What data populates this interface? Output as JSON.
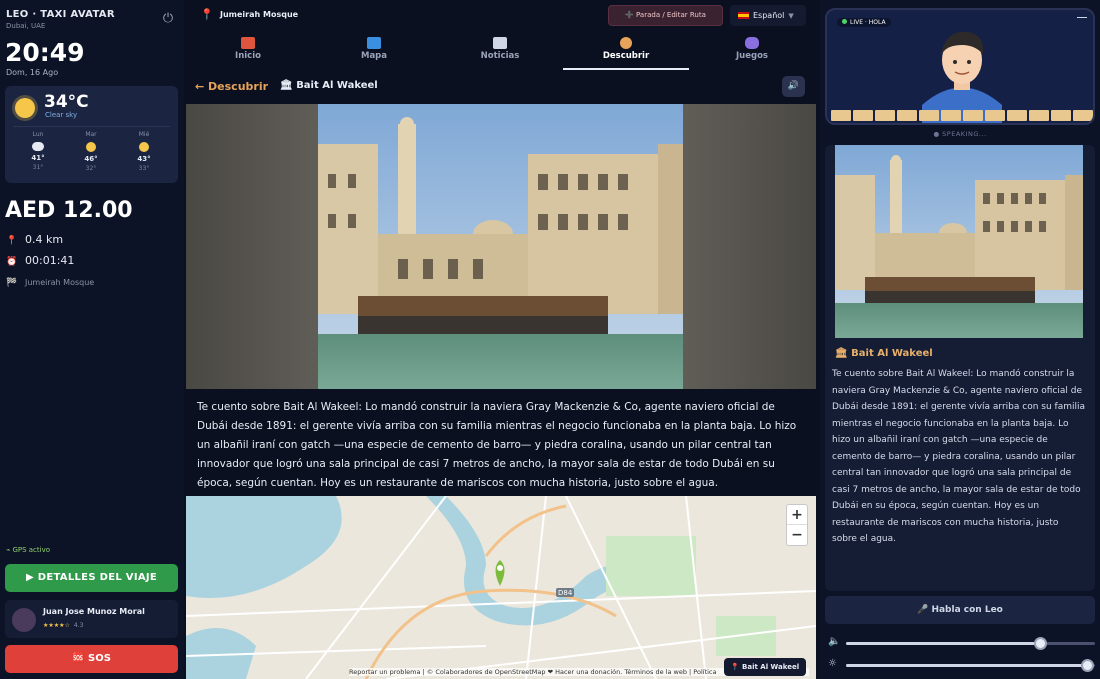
{
  "app": {
    "brand": "LEO · TAXI AVATAR",
    "location": "Dubai, UAE"
  },
  "clock": {
    "time": "20:49",
    "date": "Dom, 16 Ago"
  },
  "weather": {
    "temp": "34°C",
    "desc": "Clear sky",
    "forecast": [
      {
        "day": "Lun",
        "hi": "41°",
        "lo": "31°",
        "icon": "cloud-icon"
      },
      {
        "day": "Mar",
        "hi": "46°",
        "lo": "32°",
        "icon": "partly-sunny-icon"
      },
      {
        "day": "Mié",
        "hi": "43°",
        "lo": "33°",
        "icon": "partly-sunny-icon"
      }
    ]
  },
  "trip": {
    "fare": "AED 12.00",
    "distance": "0.4 km",
    "elapsed": "00:01:41",
    "destination": "Jumeirah Mosque"
  },
  "gps_status": "GPS activo",
  "buttons": {
    "details": "▶ DETALLES DEL VIAJE",
    "sos": "🆘 SOS",
    "talk": "🎤 Habla con Leo",
    "route": "➕ Parada / Editar Ruta"
  },
  "driver": {
    "name": "Juan Jose Munoz Moral",
    "stars": "★★★★☆",
    "rating": "4.3"
  },
  "topbar": {
    "current_location": "Jumeirah Mosque",
    "language": "Español"
  },
  "tabs": [
    {
      "label": "Inicio",
      "icon": "home-icon",
      "color": "#e0553d"
    },
    {
      "label": "Mapa",
      "icon": "map-icon",
      "color": "#3b8fe0"
    },
    {
      "label": "Noticias",
      "icon": "newspaper-icon",
      "color": "#cfd6e6"
    },
    {
      "label": "Descubrir",
      "icon": "compass-icon",
      "color": "#e8a35a"
    },
    {
      "label": "Juegos",
      "icon": "gamepad-icon",
      "color": "#8a6fe0"
    }
  ],
  "discover": {
    "back_label": "← Descubrir",
    "poi_title": "Bait Al Wakeel",
    "story": "Te cuento sobre Bait Al Wakeel: Lo mandó construir la naviera Gray Mackenzie & Co, agente naviero oficial de Dubái desde 1891: el gerente vivía arriba con su familia mientras el negocio funcionaba en la planta baja. Lo hizo un albañil iraní con gatch —una especie de cemento de barro— y piedra coralina, usando un pilar central tan innovador que logró una sala principal de casi 7 metros de ancho, la mayor sala de estar de todo Dubái en su época, según cuentan. Hoy es un restaurante de mariscos con mucha historia, justo sobre el agua."
  },
  "map": {
    "tag": "📍 Bait Al Wakeel",
    "attribution": "Reportar un problema | © Colaboradores de OpenStreetMap ❤ Hacer una donación. Términos de la web | Política",
    "road_label": "D84"
  },
  "avatar": {
    "live_label": "LIVE · HOLA",
    "status": "● SPEAKING..."
  },
  "side_card": {
    "title": "🏛 Bait Al Wakeel",
    "text": "Te cuento sobre Bait Al Wakeel: Lo mandó construir la naviera Gray Mackenzie & Co, agente naviero oficial de Dubái desde 1891: el gerente vivía arriba con su familia mientras el negocio funcionaba en la planta baja. Lo hizo un albañil iraní con gatch —una especie de cemento de barro— y piedra coralina, usando un pilar central tan innovador que logró una sala principal de casi 7 metros de ancho, la mayor sala de estar de todo Dubái en su época, según cuentan. Hoy es un restaurante de mariscos con mucha historia, justo sobre el agua."
  },
  "controls": {
    "volume": 0.78,
    "brightness": 0.97
  }
}
